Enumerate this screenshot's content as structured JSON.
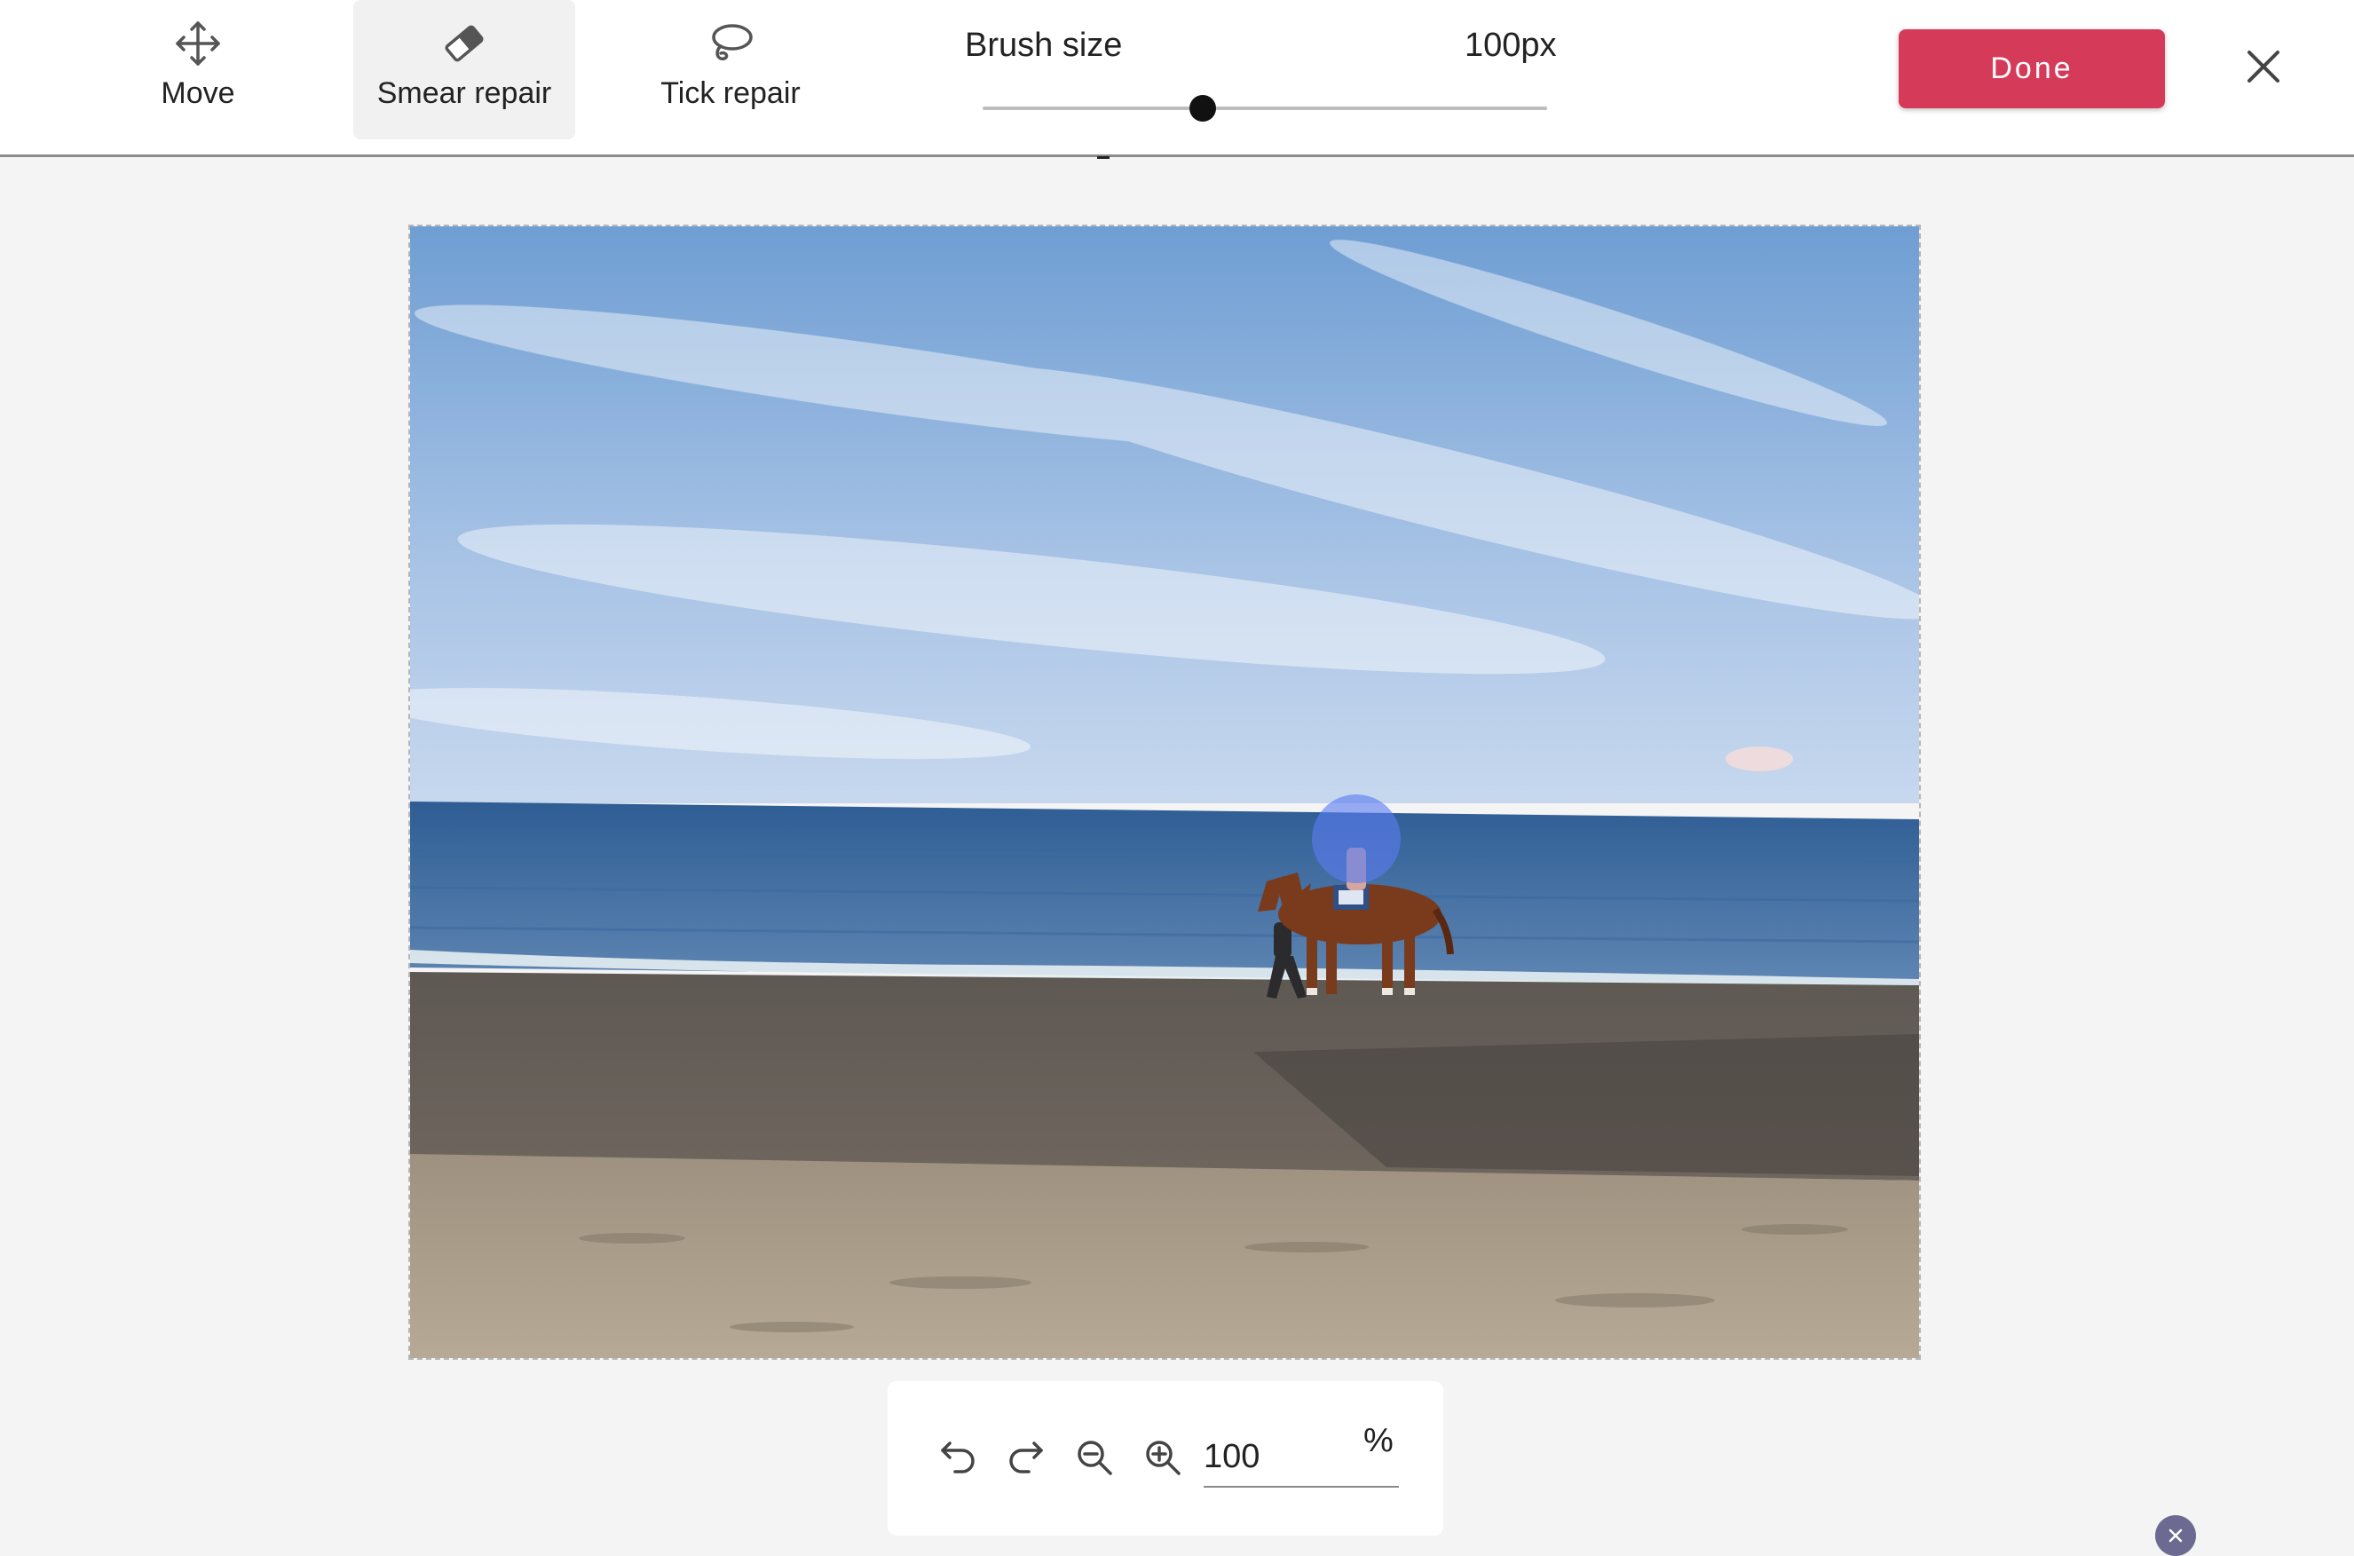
{
  "toolbar": {
    "tools": [
      {
        "label": "Move",
        "icon": "move-icon",
        "active": false
      },
      {
        "label": "Smear repair",
        "icon": "eraser-icon",
        "active": true
      },
      {
        "label": "Tick repair",
        "icon": "lasso-icon",
        "active": false
      }
    ],
    "brush": {
      "label": "Brush size",
      "value_text": "100px",
      "level": 0.39
    },
    "done_label": "Done",
    "close_icon": "close-icon"
  },
  "zoom": {
    "undo_icon": "undo-icon",
    "redo_icon": "redo-icon",
    "zoom_out_icon": "zoom-out-icon",
    "zoom_in_icon": "zoom-in-icon",
    "value": "100",
    "unit": "%"
  },
  "colors": {
    "accent": "#d63a59",
    "brush_overlay": "#5b7cf0",
    "background": "#f4f4f4"
  },
  "corner_icon": "close-icon"
}
